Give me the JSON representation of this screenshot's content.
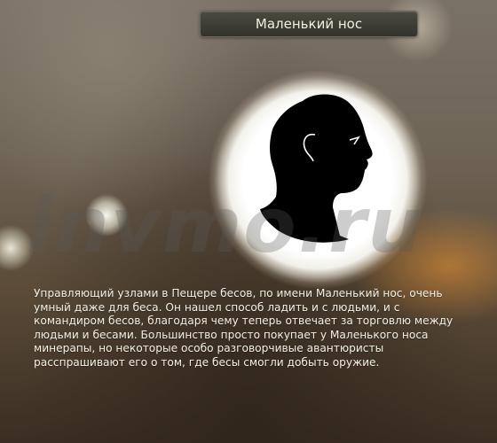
{
  "title": "Маленький нос",
  "portrait": {
    "icon": "silhouette-head-icon"
  },
  "watermark": "invmo.ru",
  "description": "Управляющий узлами в Пещере бесов, по имени Маленький нос, очень умный даже для беса. Он нашел способ ладить и с людьми, и с командиром бесов, благодаря чему теперь отвечает за торговлю между людьми и бесами. Большинство просто покупает у Маленького носа минерапы, но некоторые особо разговорчивые авантюристы расспрашивают его о том, где бесы смогли добыть оружие."
}
